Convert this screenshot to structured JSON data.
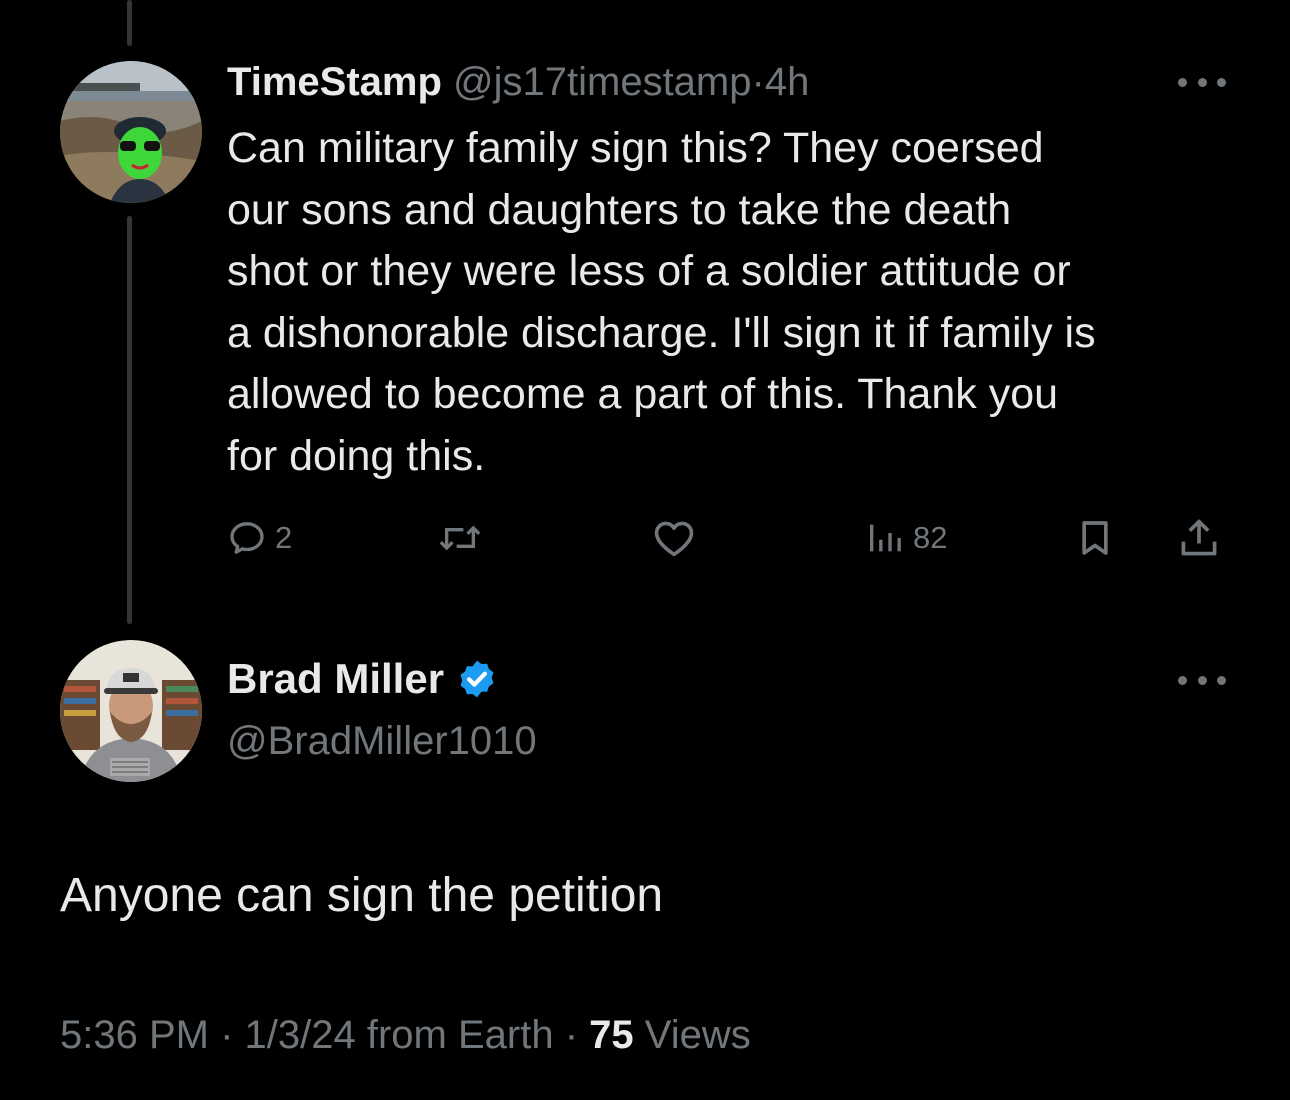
{
  "parent_tweet": {
    "display_name": "TimeStamp",
    "handle": "@js17timestamp",
    "separator": "·",
    "time_ago": "4h",
    "text_lines": [
      "Can military family sign this? They coersed",
      "our sons and daughters to take the death",
      "shot or they were less of a soldier attitude or",
      "a dishonorable discharge. I'll sign it if family is",
      "allowed to become a part of this. Thank you",
      "for doing this."
    ],
    "actions": {
      "reply_icon": "reply-icon",
      "reply_count": "2",
      "retweet_icon": "retweet-icon",
      "like_icon": "heart-icon",
      "views_icon": "views-chart-icon",
      "views_count": "82",
      "bookmark_icon": "bookmark-icon",
      "share_icon": "share-icon"
    }
  },
  "reply_tweet": {
    "display_name": "Brad Miller",
    "verified_icon": "verified-badge-icon",
    "handle": "@BradMiller1010",
    "text": "Anyone can sign the petition",
    "time": "5:36 PM",
    "date": "1/3/24 from Earth",
    "separator": "·",
    "views_count": "75",
    "views_label": "Views"
  },
  "colors": {
    "background": "#000000",
    "primary_text": "#e7e9ea",
    "secondary_text": "#71767b",
    "thread_line": "#333639",
    "verified_blue": "#1d9bf0"
  }
}
